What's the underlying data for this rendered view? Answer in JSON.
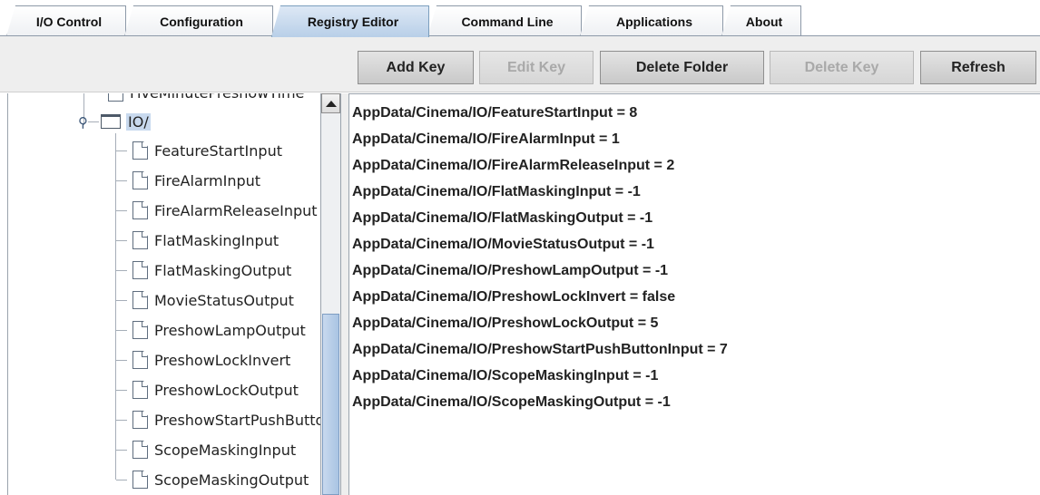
{
  "tabs": [
    {
      "label": "I/O Control",
      "active": false
    },
    {
      "label": "Configuration",
      "active": false
    },
    {
      "label": "Registry Editor",
      "active": true
    },
    {
      "label": "Command Line",
      "active": false
    },
    {
      "label": "Applications",
      "active": false
    },
    {
      "label": "About",
      "active": false
    }
  ],
  "toolbar": {
    "add_key": "Add Key",
    "edit_key": "Edit Key",
    "delete_folder": "Delete Folder",
    "delete_key": "Delete Key",
    "refresh": "Refresh"
  },
  "tree": {
    "partial_item": "FiveMinutePreshowTime",
    "folder": "IO/",
    "keys": [
      "FeatureStartInput",
      "FireAlarmInput",
      "FireAlarmReleaseInput",
      "FlatMaskingInput",
      "FlatMaskingOutput",
      "MovieStatusOutput",
      "PreshowLampOutput",
      "PreshowLockInvert",
      "PreshowLockOutput",
      "PreshowStartPushButtonInput",
      "ScopeMaskingInput",
      "ScopeMaskingOutput"
    ]
  },
  "entries": [
    "AppData/Cinema/IO/FeatureStartInput = 8",
    "AppData/Cinema/IO/FireAlarmInput = 1",
    "AppData/Cinema/IO/FireAlarmReleaseInput = 2",
    "AppData/Cinema/IO/FlatMaskingInput = -1",
    "AppData/Cinema/IO/FlatMaskingOutput = -1",
    "AppData/Cinema/IO/MovieStatusOutput = -1",
    "AppData/Cinema/IO/PreshowLampOutput = -1",
    "AppData/Cinema/IO/PreshowLockInvert = false",
    "AppData/Cinema/IO/PreshowLockOutput = 5",
    "AppData/Cinema/IO/PreshowStartPushButtonInput = 7",
    "AppData/Cinema/IO/ScopeMaskingInput = -1",
    "AppData/Cinema/IO/ScopeMaskingOutput = -1"
  ],
  "colors": {
    "active_tab": "#b8cfe8",
    "selection": "#c8d9ee",
    "disabled_text": "#a9a9a9"
  }
}
